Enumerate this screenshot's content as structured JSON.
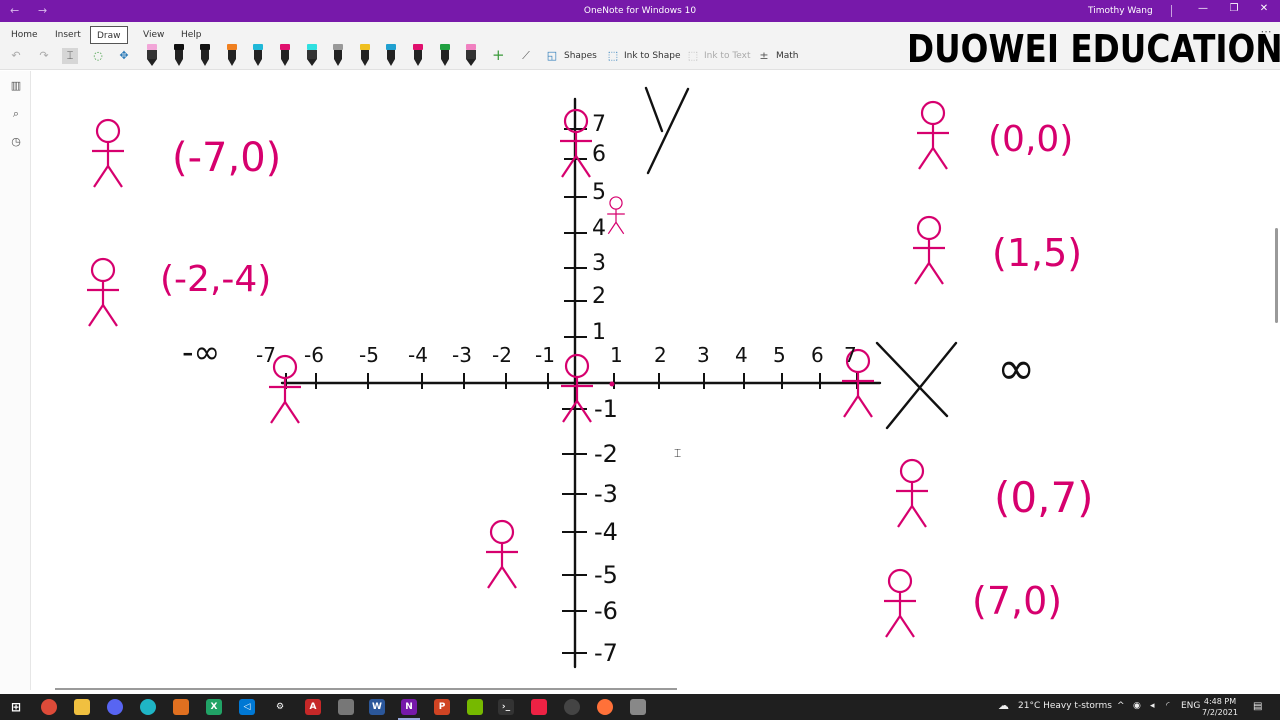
{
  "window": {
    "title": "OneNote for Windows 10",
    "user": "Timothy Wang"
  },
  "ribbon": {
    "tabs": [
      "Home",
      "Insert",
      "Draw",
      "View",
      "Help"
    ],
    "active_tab": "Draw",
    "tools": {
      "shapes": "Shapes",
      "ink_to_shape": "Ink to Shape",
      "ink_to_text": "Ink to Text",
      "math": "Math"
    },
    "pen_colors": [
      "#f2a6d8",
      "#111111",
      "#111111",
      "#f08020",
      "#20b8d8",
      "#e0106e",
      "#30e0e0",
      "#999999",
      "#f0c020",
      "#20a0d0",
      "#e0106e",
      "#20a040",
      "#f080c0"
    ]
  },
  "brand": "DUOWEI EDUCATION",
  "graph": {
    "y_label": "Y",
    "x_label": "X",
    "x_ticks": [
      "-7",
      "-6",
      "-5",
      "-4",
      "-3",
      "-2",
      "-1",
      "0",
      "1",
      "2",
      "3",
      "4",
      "5",
      "6",
      "7"
    ],
    "y_ticks_pos": [
      "7",
      "6",
      "5",
      "4",
      "3",
      "2",
      "1"
    ],
    "y_ticks_neg": [
      "-1",
      "-2",
      "-3",
      "-4",
      "-5",
      "-6",
      "-7"
    ],
    "neg_infinity": "-∞",
    "pos_infinity": "∞"
  },
  "notes": {
    "left": [
      "(-7,0)",
      "(-2,-4)"
    ],
    "right": [
      "(0,0)",
      "(1,5)",
      "(0,7)",
      "(7,0)"
    ]
  },
  "ink_color": "#d6006e",
  "taskbar": {
    "weather": "21°C  Heavy t-storms",
    "lang": "ENG",
    "time": "4:48 PM",
    "date": "7/2/2021"
  }
}
